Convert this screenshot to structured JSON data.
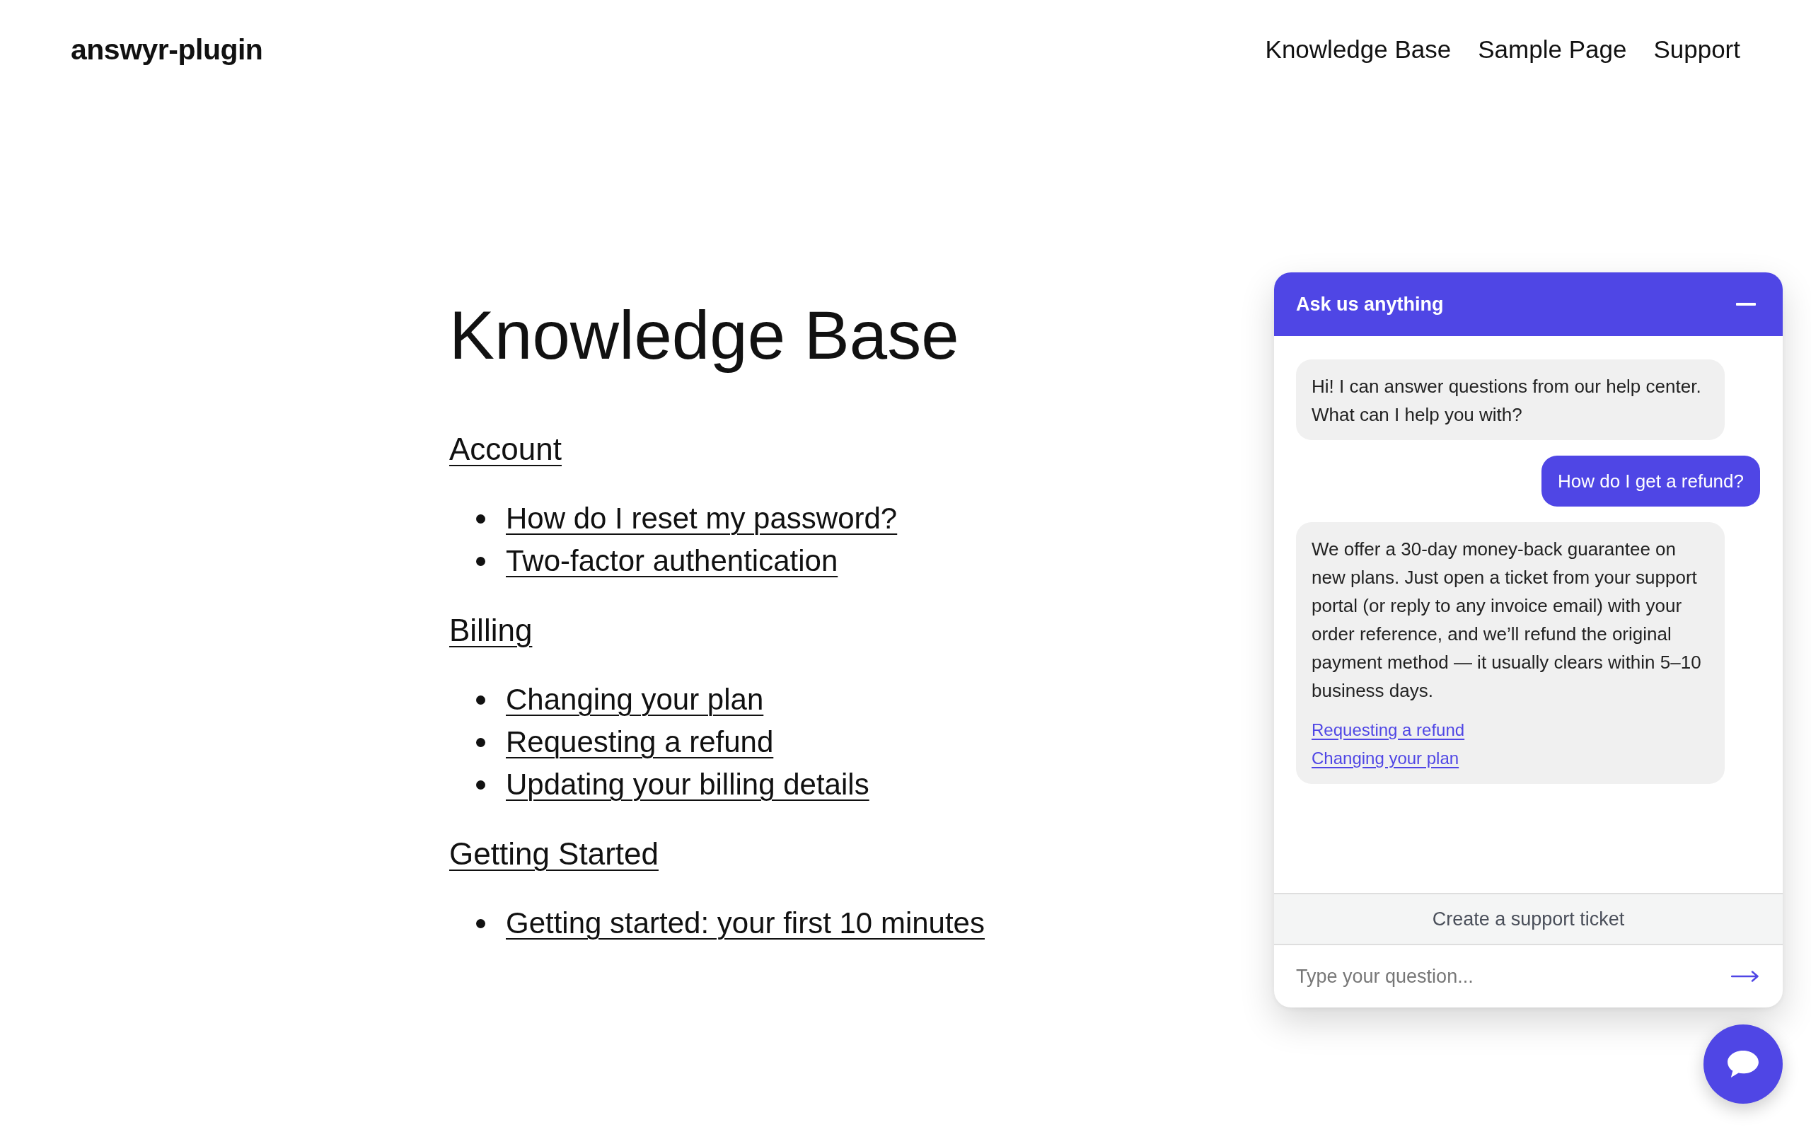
{
  "site": {
    "logo": "answyr-plugin",
    "nav": [
      {
        "label": "Knowledge Base"
      },
      {
        "label": "Sample Page"
      },
      {
        "label": "Support"
      }
    ]
  },
  "page": {
    "title": "Knowledge Base",
    "sections": [
      {
        "heading": "Account",
        "articles": [
          "How do I reset my password?",
          "Two-factor authentication"
        ]
      },
      {
        "heading": "Billing",
        "articles": [
          "Changing your plan",
          "Requesting a refund",
          "Updating your billing details"
        ]
      },
      {
        "heading": "Getting Started",
        "articles": [
          "Getting started: your first 10 minutes"
        ]
      }
    ]
  },
  "chat": {
    "title": "Ask us anything",
    "messages": [
      {
        "kind": "bot",
        "text": "Hi! I can answer questions from our help center. What can I help you with?"
      },
      {
        "kind": "user",
        "text": "How do I get a refund?"
      },
      {
        "kind": "bot",
        "text": "We offer a 30-day money-back guarantee on new plans. Just open a ticket from your support portal (or reply to any invoice email) with your order reference, and we’ll refund the original payment method — it usually clears within 5–10 business days.",
        "links": [
          "Requesting a refund",
          "Changing your plan"
        ]
      }
    ],
    "ticket_button": "Create a support ticket",
    "input": {
      "placeholder": "Type your question..."
    }
  }
}
